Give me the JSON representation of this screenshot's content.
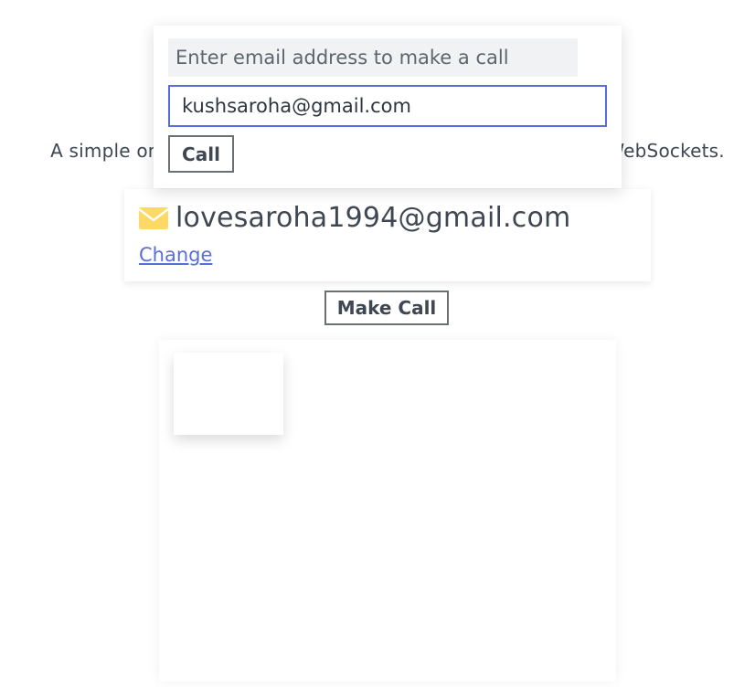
{
  "intro": {
    "subtitle": "A simple one-to-one video call app built using WebRTC and WebSockets."
  },
  "user": {
    "email": "lovesaroha1994@gmail.com",
    "change_label": "Change",
    "icon": "mail-icon",
    "icon_color": "#ffd966"
  },
  "actions": {
    "make_call_label": "Make Call"
  },
  "call_popover": {
    "hint": "Enter email address to make a call",
    "email_value": "kushsaroha@gmail.com",
    "call_label": "Call"
  },
  "colors": {
    "accent": "#5a6ed9",
    "text": "#3f4752",
    "button_border": "#6b7075"
  }
}
